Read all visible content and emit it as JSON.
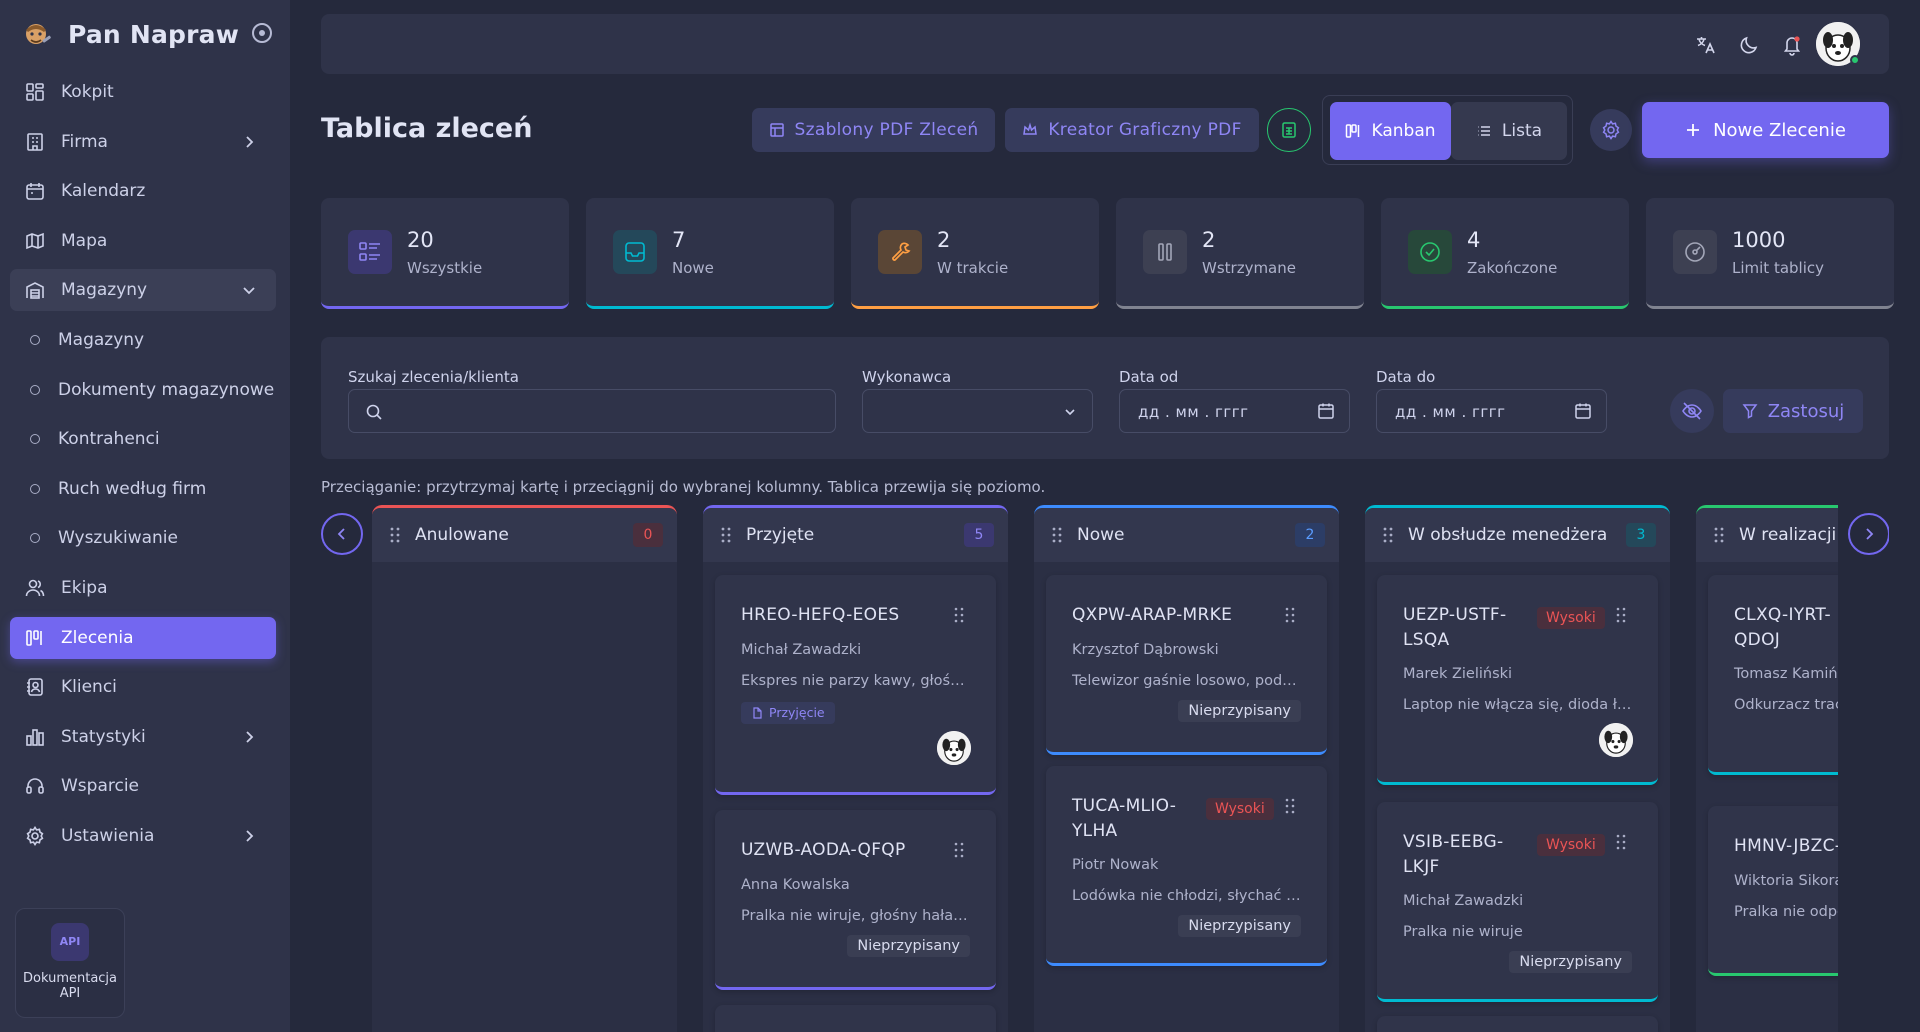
{
  "brand": {
    "name": "Pan Napraw"
  },
  "sidebar": {
    "items": [
      {
        "label": "Kokpit"
      },
      {
        "label": "Firma"
      },
      {
        "label": "Kalendarz"
      },
      {
        "label": "Mapa"
      },
      {
        "label": "Magazyny"
      },
      {
        "label": "Magazyny"
      },
      {
        "label": "Dokumenty magazynowe"
      },
      {
        "label": "Kontrahenci"
      },
      {
        "label": "Ruch według firm"
      },
      {
        "label": "Wyszukiwanie"
      },
      {
        "label": "Ekipa"
      },
      {
        "label": "Zlecenia"
      },
      {
        "label": "Klienci"
      },
      {
        "label": "Statystyki"
      },
      {
        "label": "Wsparcie"
      },
      {
        "label": "Ustawienia"
      }
    ],
    "api_card": {
      "badge": "API",
      "label_line1": "Dokumentacja",
      "label_line2": "API"
    }
  },
  "header": {
    "title": "Tablica zleceń",
    "pdf_templates": "Szablony PDF Zleceń",
    "pdf_creator": "Kreator Graficzny PDF",
    "view_kanban": "Kanban",
    "view_list": "Lista",
    "new_order": "Nowe Zlecenie"
  },
  "stats": [
    {
      "value": "20",
      "label": "Wszystkie",
      "color": "#7367f0"
    },
    {
      "value": "7",
      "label": "Nowe",
      "color": "#00bad1"
    },
    {
      "value": "2",
      "label": "W trakcie",
      "color": "#ff9f43"
    },
    {
      "value": "2",
      "label": "Wstrzymane",
      "color": "#808390"
    },
    {
      "value": "4",
      "label": "Zakończone",
      "color": "#28c76f"
    },
    {
      "value": "1000",
      "label": "Limit tablicy",
      "color": "#808390"
    }
  ],
  "filters": {
    "search_label": "Szukaj zlecenia/klienta",
    "search_placeholder": "",
    "assignee_label": "Wykonawca",
    "date_from_label": "Data od",
    "date_from_placeholder": "дд . мм . гггг",
    "date_to_label": "Data do",
    "date_to_placeholder": "дд . мм . гггг",
    "apply": "Zastosuj"
  },
  "hint": "Przeciąganie: przytrzymaj kartę i przeciągnij do wybranej kolumny. Tablica przewija się poziomo.",
  "columns": [
    {
      "title": "Anulowane",
      "count": "0",
      "color": "#ea5455",
      "badge_bg": "#4a2f3d",
      "badge_fg": "#ea5455"
    },
    {
      "title": "Przyjęte",
      "count": "5",
      "color": "#7367f0",
      "badge_bg": "#3b3870",
      "badge_fg": "#8f86f5"
    },
    {
      "title": "Nowe",
      "count": "2",
      "color": "#3d8bfd",
      "badge_bg": "#2c3d66",
      "badge_fg": "#5a9cff"
    },
    {
      "title": "W obsłudze menedżera",
      "count": "3",
      "color": "#00bad1",
      "badge_bg": "#24485a",
      "badge_fg": "#00bad1"
    },
    {
      "title": "W realizacji",
      "count": "",
      "color": "#28c76f",
      "badge_bg": "#27483a",
      "badge_fg": "#28c76f"
    }
  ],
  "cards": {
    "przyjete_1": {
      "code": "HREO-HEFQ-EOES",
      "client": "Michał Zawadzki",
      "desc": "Ekspres nie parzy kawy, głośno pracuje",
      "pill": "Przyjęcie"
    },
    "przyjete_2": {
      "code": "UZWB-AODA-QFQP",
      "client": "Anna Kowalska",
      "desc": "Pralka nie wiruje, głośny hałas podczas prania",
      "tag": "Nieprzypisany"
    },
    "nowe_1": {
      "code": "QXPW-ARAP-MRKE",
      "client": "Krzysztof Dąbrowski",
      "desc": "Telewizor gaśnie losowo, podejrzenie zasilacza",
      "tag": "Nieprzypisany"
    },
    "nowe_2": {
      "code_line1": "TUCA-MLIO-",
      "code_line2": "YLHA",
      "priority": "Wysoki",
      "client": "Piotr Nowak",
      "desc": "Lodówka nie chłodzi, słychać pracę sprężarki",
      "tag": "Nieprzypisany"
    },
    "mgr_1": {
      "code_line1": "UEZP-USTF-",
      "code_line2": "LSQA",
      "priority": "Wysoki",
      "client": "Marek Zieliński",
      "desc": "Laptop nie włącza się, dioda ładowania miga"
    },
    "mgr_2": {
      "code_line1": "VSIB-EEBG-",
      "code_line2": "LKJF",
      "priority": "Wysoki",
      "client": "Michał Zawadzki",
      "desc": "Pralka nie wiruje",
      "tag": "Nieprzypisany"
    },
    "real_1": {
      "code_line1": "CLXQ-IYRT-",
      "code_line2": "QDOJ",
      "client": "Tomasz Kamiński",
      "desc": "Odkurzacz traci moc ssania"
    },
    "real_2": {
      "code": "HMNV-JBZC-",
      "client": "Wiktoria Sikora",
      "desc": "Pralka nie odpompowuje wody"
    }
  },
  "icons": {
    "top": [
      "translate-icon",
      "moon-icon",
      "bell-icon"
    ],
    "accent": "#7367f0"
  }
}
